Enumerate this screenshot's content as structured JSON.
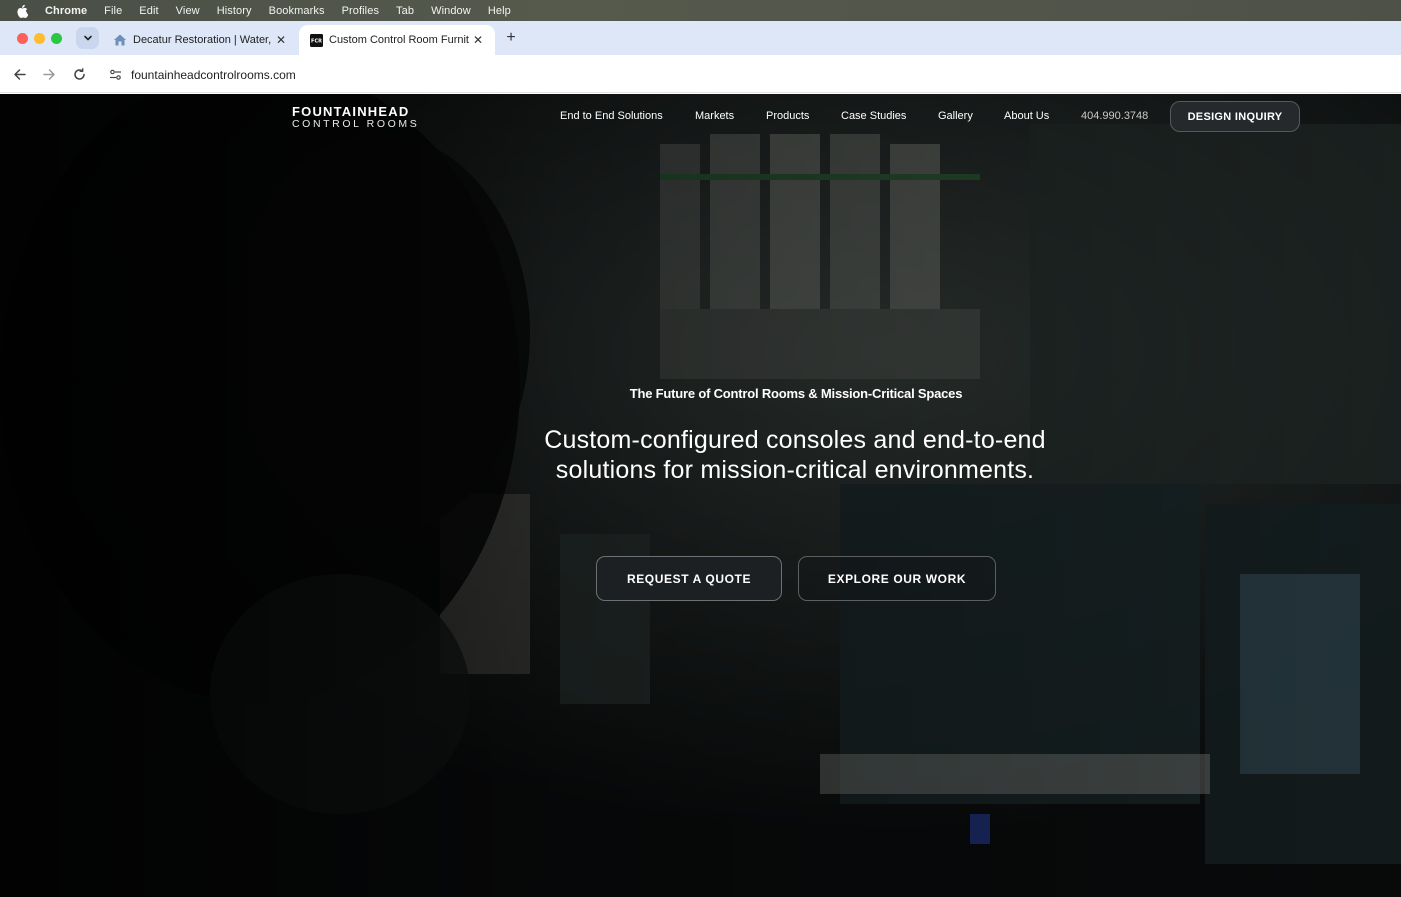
{
  "menubar": {
    "app_name": "Chrome",
    "items": [
      "File",
      "Edit",
      "View",
      "History",
      "Bookmarks",
      "Profiles",
      "Tab",
      "Window",
      "Help"
    ]
  },
  "tabs": [
    {
      "title": "Decatur Restoration | Water, F",
      "favicon": "house-icon",
      "active": false
    },
    {
      "title": "Custom Control Room Furnitu",
      "favicon": "fcr-logo-icon",
      "active": true
    }
  ],
  "toolbar": {
    "url": "fountainheadcontrolrooms.com"
  },
  "site": {
    "logo_line1": "FOUNTAINHEAD",
    "logo_line2": "CONTROL ROOMS",
    "nav": [
      "End to End Solutions",
      "Markets",
      "Products",
      "Case Studies",
      "Gallery",
      "About Us"
    ],
    "phone": "404.990.3748",
    "design_inquiry": "DESIGN INQUIRY",
    "eyebrow": "The Future of Control Rooms & Mission-Critical Spaces",
    "headline": "Custom-configured consoles and end-to-end solutions for mission-critical environments.",
    "cta_primary": "REQUEST A QUOTE",
    "cta_secondary": "EXPLORE OUR WORK"
  },
  "colors": {
    "tabstrip_bg": "#dde7f8",
    "hero_overlay": "#0b0d0e",
    "button_bg": "#1d2022"
  }
}
